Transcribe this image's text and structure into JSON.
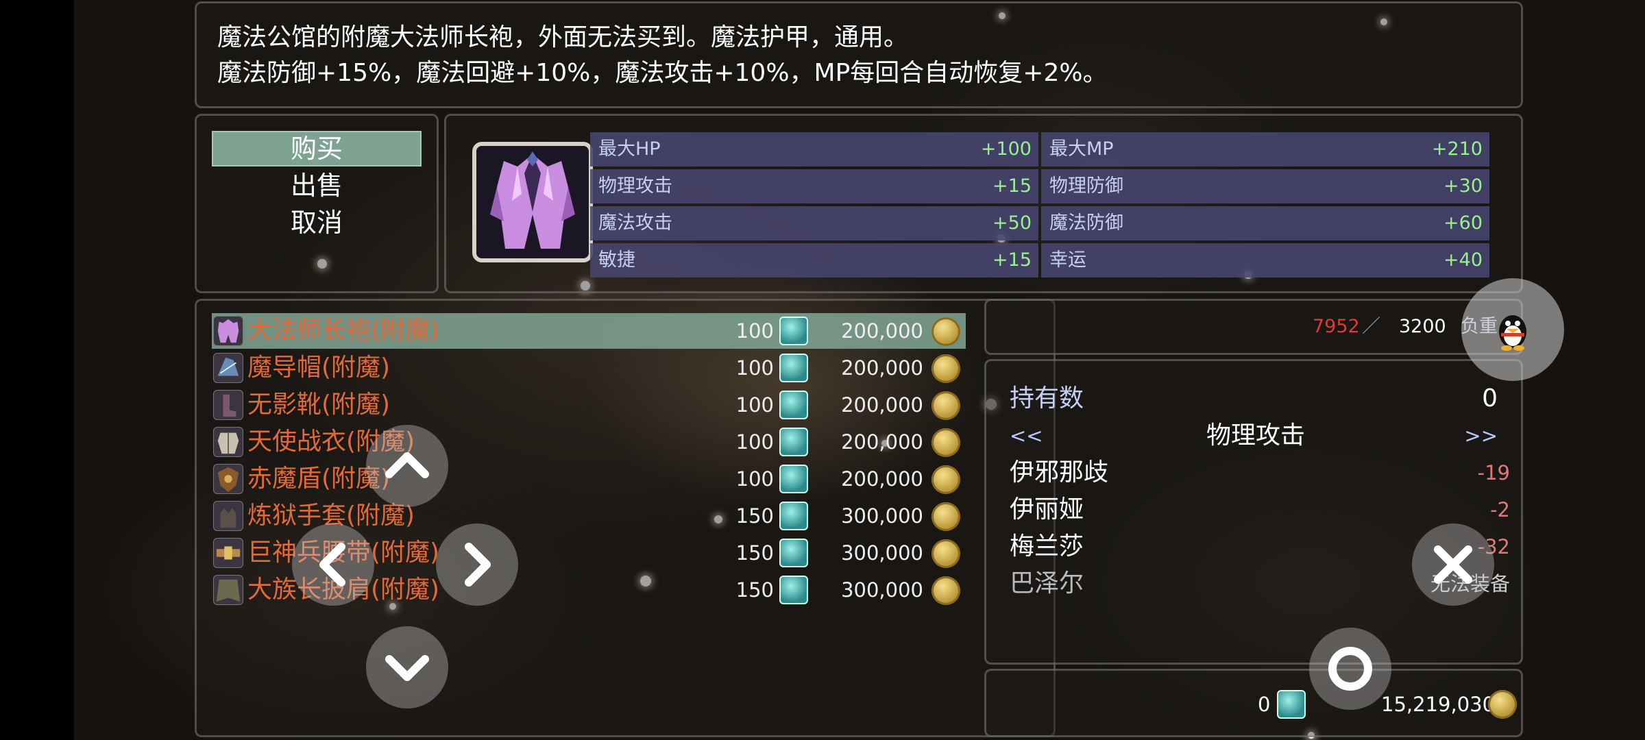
{
  "description": {
    "line1": "魔法公馆的附魔大法师长袍，外面无法买到。魔法护甲，通用。",
    "line2": "魔法防御+15%，魔法回避+10%，魔法攻击+10%，MP每回合自动恢复+2%。"
  },
  "commands": [
    "购买",
    "出售",
    "取消"
  ],
  "stats": [
    {
      "label": "最大HP",
      "value": "+100"
    },
    {
      "label": "最大MP",
      "value": "+210"
    },
    {
      "label": "物理攻击",
      "value": "+15"
    },
    {
      "label": "物理防御",
      "value": "+30"
    },
    {
      "label": "魔法攻击",
      "value": "+50"
    },
    {
      "label": "魔法防御",
      "value": "+60"
    },
    {
      "label": "敏捷",
      "value": "+15"
    },
    {
      "label": "幸运",
      "value": "+40"
    }
  ],
  "items": [
    {
      "name": "大法师长袍(附魔)",
      "qty": "100",
      "price": "200,000",
      "icon": "robe-icon"
    },
    {
      "name": "魔导帽(附魔)",
      "qty": "100",
      "price": "200,000",
      "icon": "hat-icon"
    },
    {
      "name": "无影靴(附魔)",
      "qty": "100",
      "price": "200,000",
      "icon": "boots-icon"
    },
    {
      "name": "天使战衣(附魔)",
      "qty": "100",
      "price": "200,000",
      "icon": "armor-icon"
    },
    {
      "name": "赤魔盾(附魔)",
      "qty": "100",
      "price": "200,000",
      "icon": "shield-icon"
    },
    {
      "name": "炼狱手套(附魔)",
      "qty": "150",
      "price": "300,000",
      "icon": "gloves-icon"
    },
    {
      "name": "巨神兵腰带(附魔)",
      "qty": "150",
      "price": "300,000",
      "icon": "belt-icon"
    },
    {
      "name": "大族长披肩(附魔)",
      "qty": "150",
      "price": "300,000",
      "icon": "cape-icon"
    }
  ],
  "weight": {
    "current": "7952",
    "max": "3200",
    "label": "负重"
  },
  "owned": {
    "label": "持有数",
    "count": "0"
  },
  "compare": {
    "prev": "<<",
    "next": ">>",
    "stat": "物理攻击",
    "characters": [
      {
        "name": "伊邪那歧",
        "value": "-19"
      },
      {
        "name": "伊丽娅",
        "value": "-2"
      },
      {
        "name": "梅兰莎",
        "value": "-32"
      },
      {
        "name": "巴泽尔",
        "value": "无法装备"
      }
    ]
  },
  "wallet": {
    "gems": "0",
    "gold": "15,219,030"
  },
  "colors": {
    "accent": "#7fa393",
    "item_name": "#e26a3a",
    "stat_bonus": "#9af08f",
    "stat_bg": "#484870",
    "weight_over": "#e03a3a"
  }
}
